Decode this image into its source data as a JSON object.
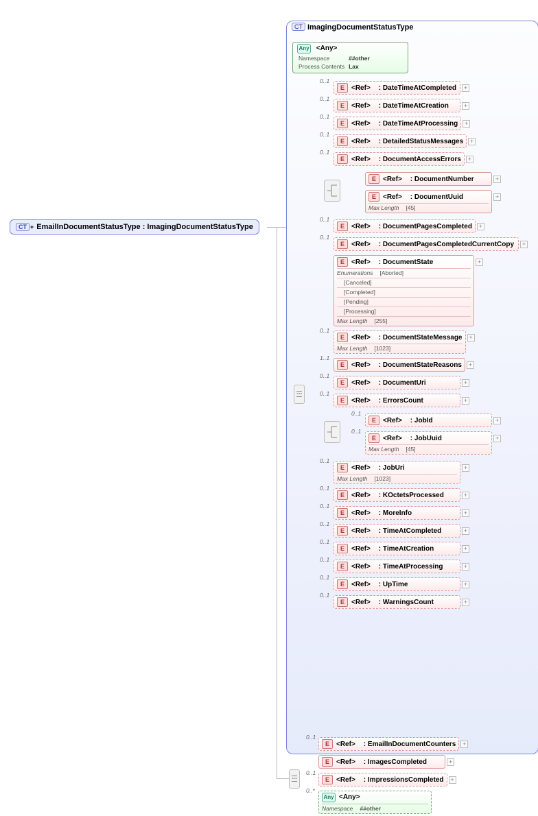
{
  "root": {
    "ct_label": "CT",
    "plus": "+",
    "name": "EmailInDocumentStatusType : ImagingDocumentStatusType"
  },
  "ctype": {
    "ct_label": "CT",
    "title": "ImagingDocumentStatusType",
    "any_top": {
      "badge": "Any",
      "title": "<Any>",
      "rows": [
        {
          "k": "Namespace",
          "v": "##other"
        },
        {
          "k": "Process Contents",
          "v": "Lax"
        }
      ]
    },
    "items": [
      {
        "occ": "0..1",
        "ref": "<Ref>",
        "name": ": DateTimeAtCompleted",
        "plus": true
      },
      {
        "occ": "0..1",
        "ref": "<Ref>",
        "name": ": DateTimeAtCreation",
        "plus": true
      },
      {
        "occ": "0..1",
        "ref": "<Ref>",
        "name": ": DateTimeAtProcessing",
        "plus": true
      },
      {
        "occ": "0..1",
        "ref": "<Ref>",
        "name": ": DetailedStatusMessages",
        "plus": true
      },
      {
        "occ": "0..1",
        "ref": "<Ref>",
        "name": ": DocumentAccessErrors",
        "plus": true
      },
      {
        "group": "choice",
        "children": [
          {
            "occ": "",
            "ref": "<Ref>",
            "name": ": DocumentNumber",
            "plus": true,
            "mand": true
          },
          {
            "occ": "",
            "ref": "<Ref>",
            "name": ": DocumentUuid",
            "plus": true,
            "mand": true,
            "facets": [
              {
                "k": "Max Length",
                "v": "[45]"
              }
            ]
          }
        ]
      },
      {
        "occ": "0..1",
        "ref": "<Ref>",
        "name": ": DocumentPagesCompleted",
        "plus": true
      },
      {
        "occ": "0..1",
        "ref": "<Ref>",
        "name": ": DocumentPagesCompletedCurrentCopy",
        "plus": true,
        "wide": true
      },
      {
        "occ": "",
        "ref": "<Ref>",
        "name": ": DocumentState",
        "mand": true,
        "big": true,
        "facets": [
          {
            "k": "Enumerations",
            "v": "[Aborted]"
          },
          {
            "k": "",
            "v": "[Canceled]"
          },
          {
            "k": "",
            "v": "[Completed]"
          },
          {
            "k": "",
            "v": "[Pending]"
          },
          {
            "k": "",
            "v": "[Processing]"
          },
          {
            "k": "Max Length",
            "v": "[255]"
          }
        ],
        "plus": true
      },
      {
        "occ": "0..1",
        "ref": "<Ref>",
        "name": ": DocumentStateMessage",
        "plus": true,
        "facets": [
          {
            "k": "Max Length",
            "v": "[1023]"
          }
        ]
      },
      {
        "occ": "1..1",
        "ref": "<Ref>",
        "name": ": DocumentStateReasons",
        "plus": true,
        "mand": true
      },
      {
        "occ": "0..1",
        "ref": "<Ref>",
        "name": ": DocumentUri",
        "plus": true
      },
      {
        "occ": "0..1",
        "ref": "<Ref>",
        "name": ": ErrorsCount",
        "plus": true
      },
      {
        "group": "choice",
        "children": [
          {
            "occ": "0..1",
            "ref": "<Ref>",
            "name": ": JobId",
            "plus": true
          },
          {
            "occ": "0..1",
            "ref": "<Ref>",
            "name": ": JobUuid",
            "plus": true,
            "facets": [
              {
                "k": "Max Length",
                "v": "[45]"
              }
            ]
          }
        ]
      },
      {
        "occ": "0..1",
        "ref": "<Ref>",
        "name": ": JobUri",
        "plus": true,
        "facets": [
          {
            "k": "Max Length",
            "v": "[1023]"
          }
        ]
      },
      {
        "occ": "0..1",
        "ref": "<Ref>",
        "name": ": KOctetsProcessed",
        "plus": true
      },
      {
        "occ": "0..1",
        "ref": "<Ref>",
        "name": ": MoreInfo",
        "plus": true
      },
      {
        "occ": "0..1",
        "ref": "<Ref>",
        "name": ": TimeAtCompleted",
        "plus": true
      },
      {
        "occ": "0..1",
        "ref": "<Ref>",
        "name": ": TimeAtCreation",
        "plus": true
      },
      {
        "occ": "0..1",
        "ref": "<Ref>",
        "name": ": TimeAtProcessing",
        "plus": true
      },
      {
        "occ": "0..1",
        "ref": "<Ref>",
        "name": ": UpTime",
        "plus": true
      },
      {
        "occ": "0..1",
        "ref": "<Ref>",
        "name": ": WarningsCount",
        "plus": true
      }
    ]
  },
  "ext": {
    "items": [
      {
        "occ": "0..1",
        "ref": "<Ref>",
        "name": ": EmailInDocumentCounters",
        "plus": true
      },
      {
        "occ": "",
        "ref": "<Ref>",
        "name": ": ImagesCompleted",
        "plus": true,
        "mand": true
      },
      {
        "occ": "0..1",
        "ref": "<Ref>",
        "name": ": ImpressionsCompleted",
        "plus": true
      },
      {
        "any": true,
        "occ": "0..*",
        "badge": "Any",
        "title": "<Any>",
        "facets": [
          {
            "k": "Namespace",
            "v": "##other"
          }
        ]
      }
    ]
  }
}
